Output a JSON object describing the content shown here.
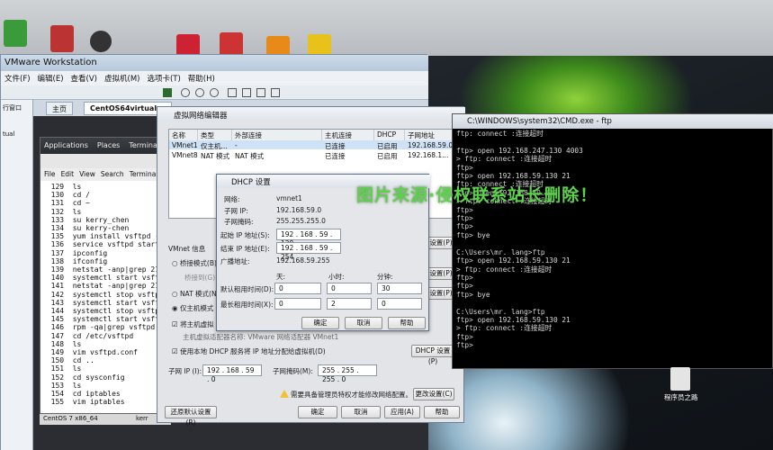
{
  "vmware": {
    "title": "VMware Workstation",
    "menu": [
      "文件(F)",
      "编辑(E)",
      "查看(V)",
      "虚拟机(M)",
      "选项卡(T)",
      "帮助(H)"
    ],
    "sidebar_label": "行窗口",
    "sidebar_item": "tual",
    "tabs": [
      "主页",
      "CentOS64virtual"
    ]
  },
  "gnome": {
    "menus": [
      "Applications",
      "Places",
      "Terminal"
    ],
    "term_menu": [
      "File",
      "Edit",
      "View",
      "Search",
      "Terminal"
    ],
    "lines": [
      "  129  ls",
      "  130  cd /",
      "  131  cd ~",
      "  132  ls",
      "  133  su kerry_chen",
      "  134  su kerry-chen",
      "  135  yum install vsftpd -y",
      "  136  service vsftpd start",
      "  137  ipconfig",
      "  138  ifconfig",
      "  139  netstat -anp|grep 21",
      "  140  systemctl start vsftpd",
      "  141  netstat -anp|grep 21",
      "  142  systemctl stop vsftpd",
      "  143  systemctl start vsftpd",
      "  144  systemctl stop vsftpd",
      "  145  systemctl start vsftpd",
      "  146  rpm -qa|grep vsftpd",
      "  147  cd /etc/vsftpd",
      "  148  ls",
      "  149  vim vsftpd.conf",
      "  150  cd ..",
      "  151  ls",
      "  152  cd sysconfig",
      "  153  ls",
      "  154  cd iptables",
      "  155  vim iptables"
    ],
    "footer": "CentOS 7 x86_64",
    "taskbar_item": "kerr"
  },
  "net_editor": {
    "title": "虚拟网络编辑器",
    "columns": [
      "名称",
      "类型",
      "外部连接",
      "主机连接",
      "DHCP",
      "子网地址"
    ],
    "rows": [
      [
        "VMnet1",
        "仅主机...",
        "-",
        "已连接",
        "已启用",
        "192.168.59.0"
      ],
      [
        "VMnet8",
        "NAT 模式",
        "NAT 模式",
        "已连接",
        "已启用",
        "192.168.1..."
      ]
    ],
    "info_label": "VMnet 信息",
    "bridge_label": "桥接模式(B)",
    "bridge_to": "桥接到(G):",
    "nat_label": "NAT 模式(N",
    "hostonly_label": "仅主机模式",
    "connect_host": "将主机虚拟",
    "host_adapter": "主机虚拟适配器名称: VMware 网络适配器 VMnet1",
    "use_dhcp": "使用本地 DHCP 服务将 IP 地址分配给虚拟机(D)",
    "dhcp_settings_btn": "DHCP 设置(P)",
    "subnet_ip_label": "子网 IP (I):",
    "subnet_ip": "192 . 168 . 59 . 0",
    "subnet_mask_label": "子网掩码(M):",
    "subnet_mask": "255 . 255 . 255 . 0",
    "admin_note": "需要具备管理员特权才能修改网络配置。",
    "change_settings_btn": "更改设置(C)",
    "restore_btn": "还原默认设置(R)",
    "ok_btn": "确定",
    "cancel_btn": "取消",
    "apply_btn": "应用(A)",
    "help_btn": "帮助",
    "side_btns": [
      "设置(P)",
      "设置(P)",
      "设置(P)"
    ]
  },
  "dhcp": {
    "title": "DHCP 设置",
    "network_label": "网络:",
    "network": "vmnet1",
    "subnet_ip_label": "子网 IP:",
    "subnet_ip": "192.168.59.0",
    "mask_label": "子网掩码:",
    "mask": "255.255.255.0",
    "start_label": "起始 IP 地址(S):",
    "start": "192 . 168 . 59 . 128",
    "end_label": "结束 IP 地址(E):",
    "end": "192 . 168 . 59 . 254",
    "broadcast_label": "广播地址:",
    "broadcast": "192.168.59.255",
    "days": "天:",
    "hours": "小时:",
    "minutes": "分钟:",
    "default_lease": "默认租用时间(D):",
    "max_lease": "最长租用时间(X):",
    "default_vals": [
      "0",
      "0",
      "30"
    ],
    "max_vals": [
      "0",
      "2",
      "0"
    ],
    "ok": "确定",
    "cancel": "取消",
    "help": "帮助"
  },
  "cmd": {
    "title": "C:\\WINDOWS\\system32\\CMD.exe - ftp",
    "text": "ftp: connect :连接超时\n\nftp> open 192.168.247.130 4003\n> ftp: connect :连接超时\nftp>\nftp> open 192.168.59.130 21\nftp: connect :连接超时\nftp> open 192.168.59.130 21\n> ftp: connect :连接超时\nftp>\nftp>\nftp>\nftp> bye\n\nC:\\Users\\mr. lang>ftp\nftp> open 192.168.59.130 21\n> ftp: connect :连接超时\nftp>\nftp>\nftp> bye\n\nC:\\Users\\mr. lang>ftp\nftp> open 192.168.59.130 21\n> ftp: connect :连接超时\nftp>\nftp>"
  },
  "watermark": "图片来源·侵权联系站长删除！",
  "desktop_icon_label": "程序员之路",
  "colors": {
    "cmd_bg": "#000000",
    "cmd_fg": "#d8d8d8",
    "watermark": "#5bd24a",
    "vmware_chrome": "#d6dde6"
  }
}
